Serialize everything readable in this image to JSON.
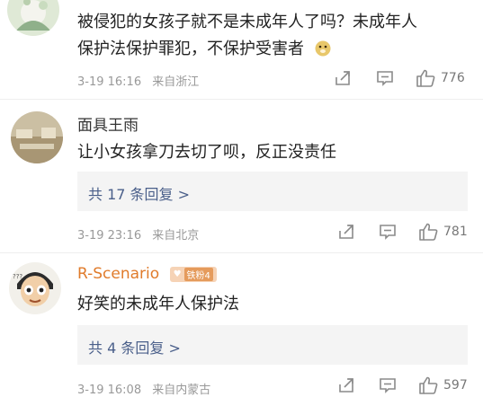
{
  "comments": [
    {
      "text_lines": [
        "被侵犯的女孩子就不是未成年人了吗？未成年人",
        "保护法保护罪犯，不保护受害者"
      ],
      "emoji": "doge-emoji",
      "date": "3-19 16:16",
      "location": "来自浙江",
      "likes": "776"
    },
    {
      "username": "面具王雨",
      "text_lines": [
        "让小女孩拿刀去切了呗，反正没责任"
      ],
      "replies": "共 17 条回复 >",
      "date": "3-19 23:16",
      "location": "来自北京",
      "likes": "781"
    },
    {
      "username": "R-Scenario",
      "badge": "铁粉4",
      "text_lines": [
        "好笑的未成年人保护法"
      ],
      "replies": "共 4 条回复 >",
      "date": "3-19 16:08",
      "location": "来自内蒙古",
      "likes": "597"
    }
  ],
  "icons": {
    "share": "share-icon",
    "comment": "comment-icon",
    "like": "thumbs-up-icon"
  },
  "colors": {
    "reply_link": "#4a5f8a",
    "username_highlight": "#e07b2b",
    "reply_bg": "#f4f4f4"
  }
}
